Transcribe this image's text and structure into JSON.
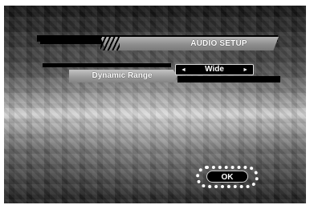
{
  "menu": {
    "title": "AUDIO SETUP"
  },
  "setting": {
    "label": "Dynamic Range",
    "value": "Wide",
    "left_arrow": "◄",
    "right_arrow": "►"
  },
  "buttons": {
    "ok_label": "OK"
  },
  "colors": {
    "accent_text": "#ffffff",
    "bar_black": "#000000",
    "bar_gray": "#9a9a9a"
  }
}
